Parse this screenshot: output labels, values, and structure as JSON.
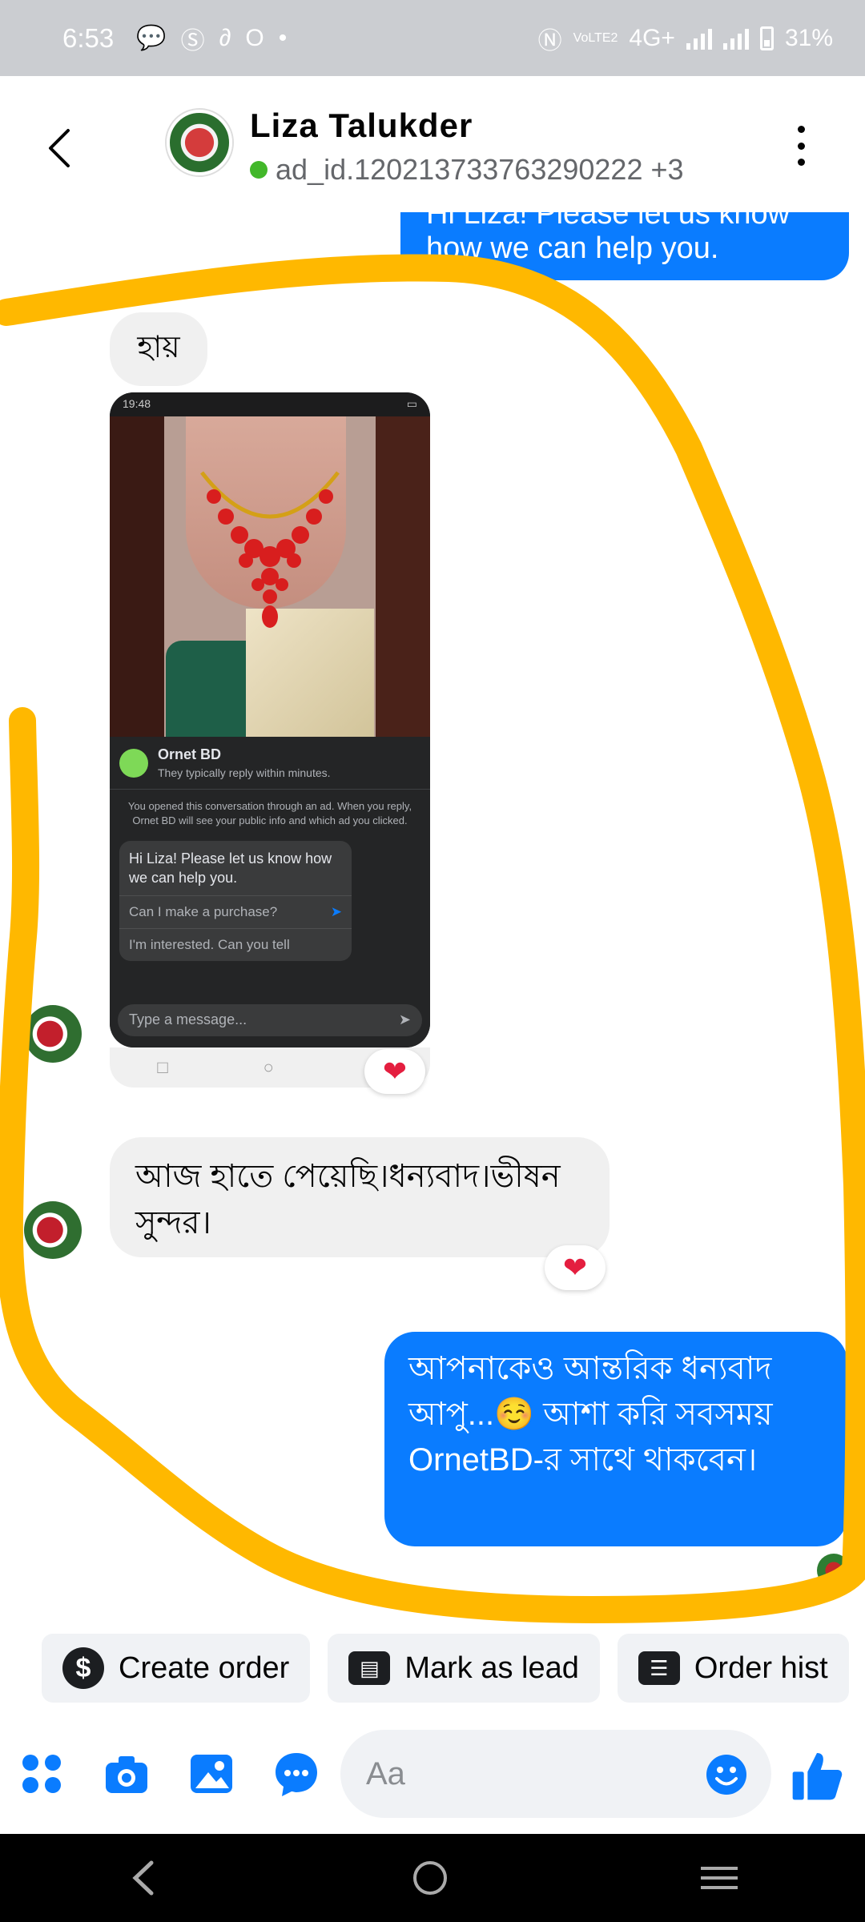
{
  "status_bar": {
    "time": "6:53",
    "network": "4G+",
    "volte": "VoLTE2",
    "battery": "31%"
  },
  "header": {
    "name": "Liza Talukder",
    "subtitle": "ad_id.120213733763290222 +3"
  },
  "messages": {
    "outgoing_partial": "Hi Liza! Please let us know how we can help you.",
    "incoming_1": "হায়",
    "incoming_2": "আজ হাতে পেয়েছি।ধন্যবাদ।ভীষন সুন্দর।",
    "outgoing_final": "আপনাকেও আন্তরিক ধন্যবাদ আপু...☺️ আশা করি সবসময় OrnetBD-র সাথে থাকবেন।",
    "reaction": "❤"
  },
  "shared_screenshot": {
    "time": "19:48",
    "page_name": "Ornet BD",
    "page_sub": "They typically reply within minutes.",
    "notice": "You opened this conversation through an ad. When you reply, Ornet BD will see your public info and which ad you clicked.",
    "card_text": "Hi Liza! Please let us know how we can help you.",
    "option_1": "Can I make a purchase?",
    "option_2": "I'm interested. Can you tell",
    "input_placeholder": "Type a message..."
  },
  "quick_actions": {
    "create_order": "Create order",
    "mark_as_lead": "Mark as lead",
    "order_history": "Order hist"
  },
  "composer": {
    "placeholder": "Aa"
  },
  "colors": {
    "accent": "#0a7cff",
    "scribble": "#ffb800",
    "heart": "#e41e3f"
  },
  "icons": [
    "back-icon",
    "more-icon",
    "apps-icon",
    "camera-icon",
    "gallery-icon",
    "chat-icon",
    "emoji-icon",
    "like-icon"
  ]
}
